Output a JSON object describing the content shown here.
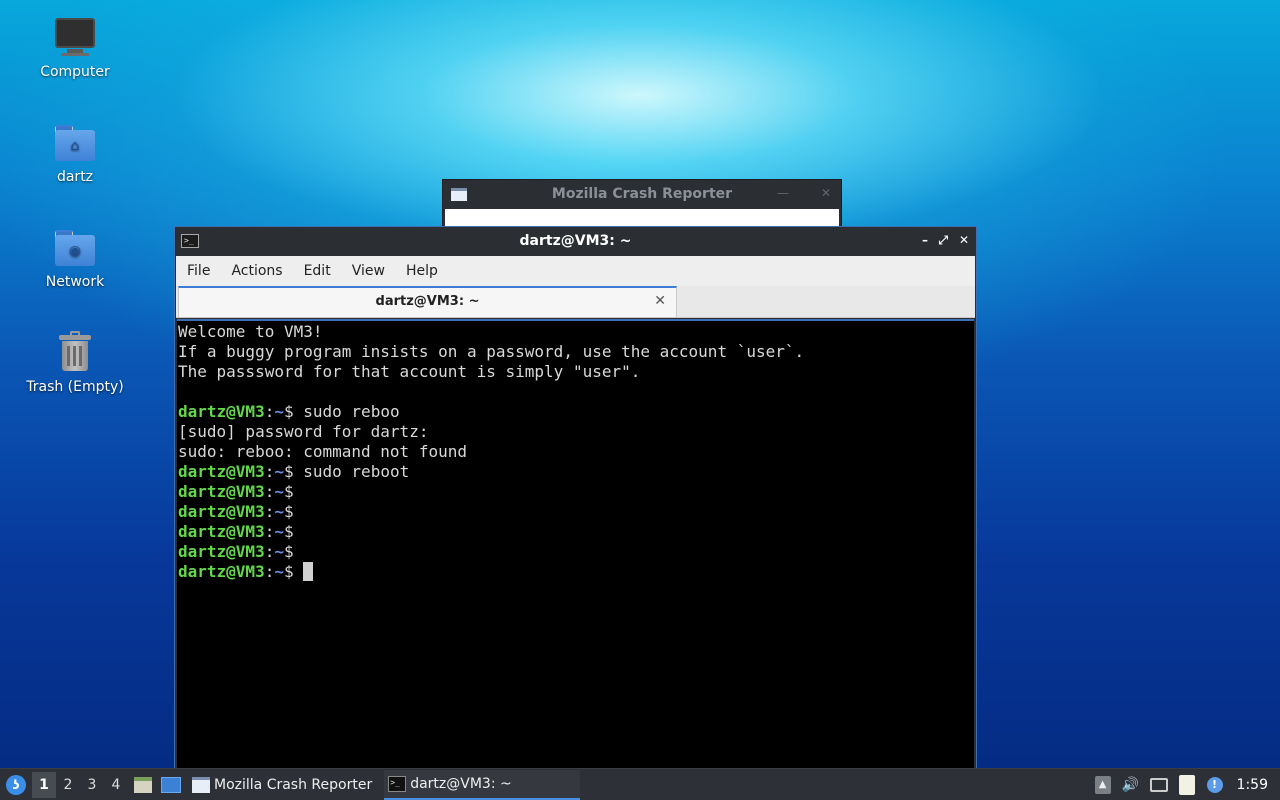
{
  "desktop": {
    "icons": [
      {
        "label": "Computer"
      },
      {
        "label": "dartz"
      },
      {
        "label": "Network"
      },
      {
        "label": "Trash (Empty)"
      }
    ]
  },
  "crash_reporter": {
    "title": "Mozilla Crash Reporter"
  },
  "terminal": {
    "title": "dartz@VM3: ~",
    "menu": [
      "File",
      "Actions",
      "Edit",
      "View",
      "Help"
    ],
    "tab_label": "dartz@VM3: ~",
    "prompt_user": "dartz@VM3",
    "prompt_sep": ":",
    "prompt_path": "~",
    "prompt_char": "$",
    "lines": [
      {
        "type": "text",
        "text": "Welcome to VM3!"
      },
      {
        "type": "text",
        "text": "If a buggy program insists on a password, use the account `user`."
      },
      {
        "type": "text",
        "text": "The passsword for that account is simply \"user\"."
      },
      {
        "type": "text",
        "text": ""
      },
      {
        "type": "prompt",
        "text": " sudo reboo"
      },
      {
        "type": "text",
        "text": "[sudo] password for dartz:"
      },
      {
        "type": "text",
        "text": "sudo: reboo: command not found"
      },
      {
        "type": "prompt",
        "text": " sudo reboot"
      },
      {
        "type": "prompt",
        "text": ""
      },
      {
        "type": "prompt",
        "text": ""
      },
      {
        "type": "prompt",
        "text": ""
      },
      {
        "type": "prompt",
        "text": ""
      },
      {
        "type": "prompt",
        "text": " ",
        "cursor": true
      }
    ]
  },
  "taskbar": {
    "workspaces": [
      "1",
      "2",
      "3",
      "4"
    ],
    "active_workspace": "1",
    "tasks": [
      {
        "label": "Mozilla Crash Reporter",
        "icon": "window-icon",
        "active": false
      },
      {
        "label": "dartz@VM3: ~",
        "icon": "terminal-icon",
        "active": true
      }
    ],
    "clock": "1:59"
  }
}
